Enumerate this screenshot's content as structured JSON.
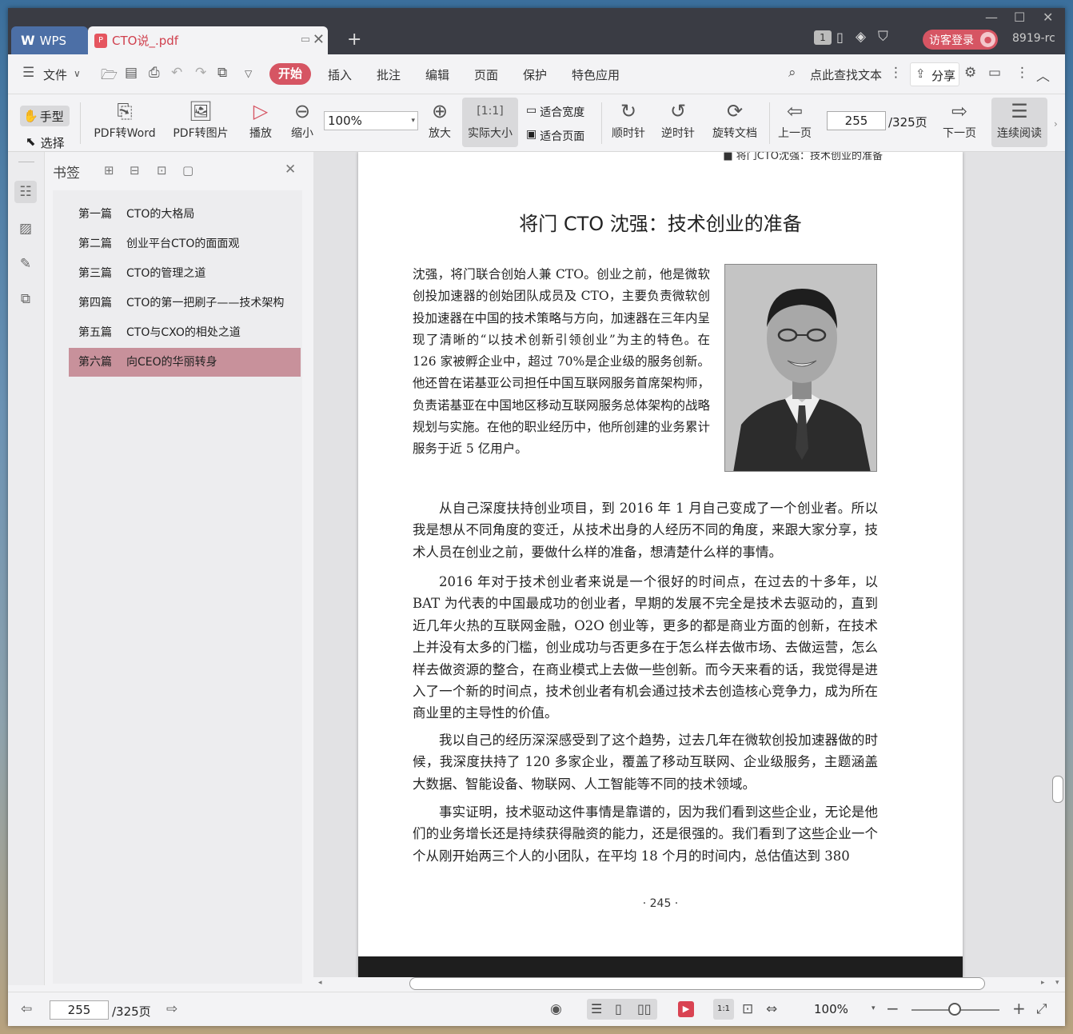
{
  "titlebar": {
    "app_tab": "WPS",
    "doc_tab": "CTO说_.pdf",
    "new_tab_icon": "plus-icon",
    "page_badge": "1",
    "visitor_login": "访客登录",
    "user_id": "8919-rc"
  },
  "menu": {
    "file": "文件",
    "active": "开始",
    "items": [
      "插入",
      "批注",
      "编辑",
      "页面",
      "保护",
      "特色应用"
    ],
    "search": "点此查找文本",
    "share": "分享"
  },
  "toolbar": {
    "hand": "手型",
    "select": "选择",
    "pdf_to_word": "PDF转Word",
    "pdf_to_image": "PDF转图片",
    "play": "播放",
    "zoom_out": "缩小",
    "zoom_value": "100%",
    "zoom_in": "放大",
    "actual_size": "实际大小",
    "fit_width": "适合宽度",
    "fit_page": "适合页面",
    "rotate_cw": "顺时针",
    "rotate_ccw": "逆时针",
    "rotate_doc": "旋转文档",
    "prev_page": "上一页",
    "page_current": "255",
    "page_total": "/325页",
    "next_page": "下一页",
    "continuous": "连续阅读"
  },
  "bookmarks": {
    "title": "书签",
    "items": [
      {
        "num": "第一篇",
        "title": "CTO的大格局"
      },
      {
        "num": "第二篇",
        "title": "创业平台CTO的面面观"
      },
      {
        "num": "第三篇",
        "title": "CTO的管理之道"
      },
      {
        "num": "第四篇",
        "title": "CTO的第一把刷子——技术架构"
      },
      {
        "num": "第五篇",
        "title": "CTO与CXO的相处之道"
      },
      {
        "num": "第六篇",
        "title": "向CEO的华丽转身"
      }
    ]
  },
  "page": {
    "running_head": "■ 将门CTO沈强：技术创业的准备",
    "title": "将门 CTO 沈强：技术创业的准备",
    "intro": "沈强，将门联合创始人兼 CTO。创业之前，他是微软创投加速器的创始团队成员及 CTO，主要负责微软创投加速器在中国的技术策略与方向，加速器在三年内呈现了清晰的“以技术创新引领创业”为主的特色。在 126 家被孵企业中，超过 70%是企业级的服务创新。他还曾在诺基亚公司担任中国互联网服务首席架构师，负责诺基亚在中国地区移动互联网服务总体架构的战略规划与实施。在他的职业经历中，他所创建的业务累计服务于近 5 亿用户。",
    "paragraphs": [
      "从自己深度扶持创业项目，到 2016 年 1 月自己变成了一个创业者。所以我是想从不同角度的变迁，从技术出身的人经历不同的角度，来跟大家分享，技术人员在创业之前，要做什么样的准备，想清楚什么样的事情。",
      "2016 年对于技术创业者来说是一个很好的时间点，在过去的十多年，以 BAT 为代表的中国最成功的创业者，早期的发展不完全是技术去驱动的，直到近几年火热的互联网金融，O2O 创业等，更多的都是商业方面的创新，在技术上并没有太多的门槛，创业成功与否更多在于怎么样去做市场、去做运营，怎么样去做资源的整合，在商业模式上去做一些创新。而今天来看的话，我觉得是进入了一个新的时间点，技术创业者有机会通过技术去创造核心竞争力，成为所在商业里的主导性的价值。",
      "我以自己的经历深深感受到了这个趋势，过去几年在微软创投加速器做的时候，我深度扶持了 120 多家企业，覆盖了移动互联网、企业级服务，主题涵盖大数据、智能设备、物联网、人工智能等不同的技术领域。",
      "事实证明，技术驱动这件事情是靠谱的，因为我们看到这些企业，无论是他们的业务增长还是持续获得融资的能力，还是很强的。我们看到了这些企业一个个从刚开始两三个人的小团队，在平均 18 个月的时间内，总估值达到 380"
    ],
    "page_number": "· 245 ·"
  },
  "status": {
    "page_current": "255",
    "page_total": "/325页",
    "zoom": "100%"
  },
  "colors": {
    "accent": "#d65563",
    "bookmark_selected": "#c8919b",
    "titlebar": "#3a3c44"
  }
}
